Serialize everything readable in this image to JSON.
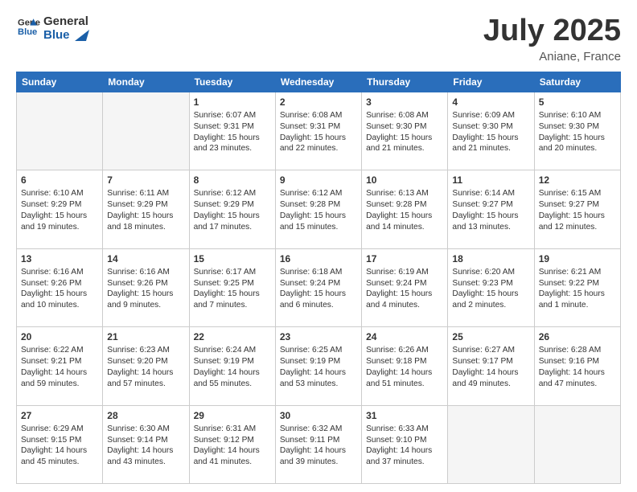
{
  "header": {
    "logo_line1": "General",
    "logo_line2": "Blue",
    "month": "July 2025",
    "location": "Aniane, France"
  },
  "days_of_week": [
    "Sunday",
    "Monday",
    "Tuesday",
    "Wednesday",
    "Thursday",
    "Friday",
    "Saturday"
  ],
  "weeks": [
    [
      {
        "day": "",
        "info": ""
      },
      {
        "day": "",
        "info": ""
      },
      {
        "day": "1",
        "info": "Sunrise: 6:07 AM\nSunset: 9:31 PM\nDaylight: 15 hours and 23 minutes."
      },
      {
        "day": "2",
        "info": "Sunrise: 6:08 AM\nSunset: 9:31 PM\nDaylight: 15 hours and 22 minutes."
      },
      {
        "day": "3",
        "info": "Sunrise: 6:08 AM\nSunset: 9:30 PM\nDaylight: 15 hours and 21 minutes."
      },
      {
        "day": "4",
        "info": "Sunrise: 6:09 AM\nSunset: 9:30 PM\nDaylight: 15 hours and 21 minutes."
      },
      {
        "day": "5",
        "info": "Sunrise: 6:10 AM\nSunset: 9:30 PM\nDaylight: 15 hours and 20 minutes."
      }
    ],
    [
      {
        "day": "6",
        "info": "Sunrise: 6:10 AM\nSunset: 9:29 PM\nDaylight: 15 hours and 19 minutes."
      },
      {
        "day": "7",
        "info": "Sunrise: 6:11 AM\nSunset: 9:29 PM\nDaylight: 15 hours and 18 minutes."
      },
      {
        "day": "8",
        "info": "Sunrise: 6:12 AM\nSunset: 9:29 PM\nDaylight: 15 hours and 17 minutes."
      },
      {
        "day": "9",
        "info": "Sunrise: 6:12 AM\nSunset: 9:28 PM\nDaylight: 15 hours and 15 minutes."
      },
      {
        "day": "10",
        "info": "Sunrise: 6:13 AM\nSunset: 9:28 PM\nDaylight: 15 hours and 14 minutes."
      },
      {
        "day": "11",
        "info": "Sunrise: 6:14 AM\nSunset: 9:27 PM\nDaylight: 15 hours and 13 minutes."
      },
      {
        "day": "12",
        "info": "Sunrise: 6:15 AM\nSunset: 9:27 PM\nDaylight: 15 hours and 12 minutes."
      }
    ],
    [
      {
        "day": "13",
        "info": "Sunrise: 6:16 AM\nSunset: 9:26 PM\nDaylight: 15 hours and 10 minutes."
      },
      {
        "day": "14",
        "info": "Sunrise: 6:16 AM\nSunset: 9:26 PM\nDaylight: 15 hours and 9 minutes."
      },
      {
        "day": "15",
        "info": "Sunrise: 6:17 AM\nSunset: 9:25 PM\nDaylight: 15 hours and 7 minutes."
      },
      {
        "day": "16",
        "info": "Sunrise: 6:18 AM\nSunset: 9:24 PM\nDaylight: 15 hours and 6 minutes."
      },
      {
        "day": "17",
        "info": "Sunrise: 6:19 AM\nSunset: 9:24 PM\nDaylight: 15 hours and 4 minutes."
      },
      {
        "day": "18",
        "info": "Sunrise: 6:20 AM\nSunset: 9:23 PM\nDaylight: 15 hours and 2 minutes."
      },
      {
        "day": "19",
        "info": "Sunrise: 6:21 AM\nSunset: 9:22 PM\nDaylight: 15 hours and 1 minute."
      }
    ],
    [
      {
        "day": "20",
        "info": "Sunrise: 6:22 AM\nSunset: 9:21 PM\nDaylight: 14 hours and 59 minutes."
      },
      {
        "day": "21",
        "info": "Sunrise: 6:23 AM\nSunset: 9:20 PM\nDaylight: 14 hours and 57 minutes."
      },
      {
        "day": "22",
        "info": "Sunrise: 6:24 AM\nSunset: 9:19 PM\nDaylight: 14 hours and 55 minutes."
      },
      {
        "day": "23",
        "info": "Sunrise: 6:25 AM\nSunset: 9:19 PM\nDaylight: 14 hours and 53 minutes."
      },
      {
        "day": "24",
        "info": "Sunrise: 6:26 AM\nSunset: 9:18 PM\nDaylight: 14 hours and 51 minutes."
      },
      {
        "day": "25",
        "info": "Sunrise: 6:27 AM\nSunset: 9:17 PM\nDaylight: 14 hours and 49 minutes."
      },
      {
        "day": "26",
        "info": "Sunrise: 6:28 AM\nSunset: 9:16 PM\nDaylight: 14 hours and 47 minutes."
      }
    ],
    [
      {
        "day": "27",
        "info": "Sunrise: 6:29 AM\nSunset: 9:15 PM\nDaylight: 14 hours and 45 minutes."
      },
      {
        "day": "28",
        "info": "Sunrise: 6:30 AM\nSunset: 9:14 PM\nDaylight: 14 hours and 43 minutes."
      },
      {
        "day": "29",
        "info": "Sunrise: 6:31 AM\nSunset: 9:12 PM\nDaylight: 14 hours and 41 minutes."
      },
      {
        "day": "30",
        "info": "Sunrise: 6:32 AM\nSunset: 9:11 PM\nDaylight: 14 hours and 39 minutes."
      },
      {
        "day": "31",
        "info": "Sunrise: 6:33 AM\nSunset: 9:10 PM\nDaylight: 14 hours and 37 minutes."
      },
      {
        "day": "",
        "info": ""
      },
      {
        "day": "",
        "info": ""
      }
    ]
  ]
}
